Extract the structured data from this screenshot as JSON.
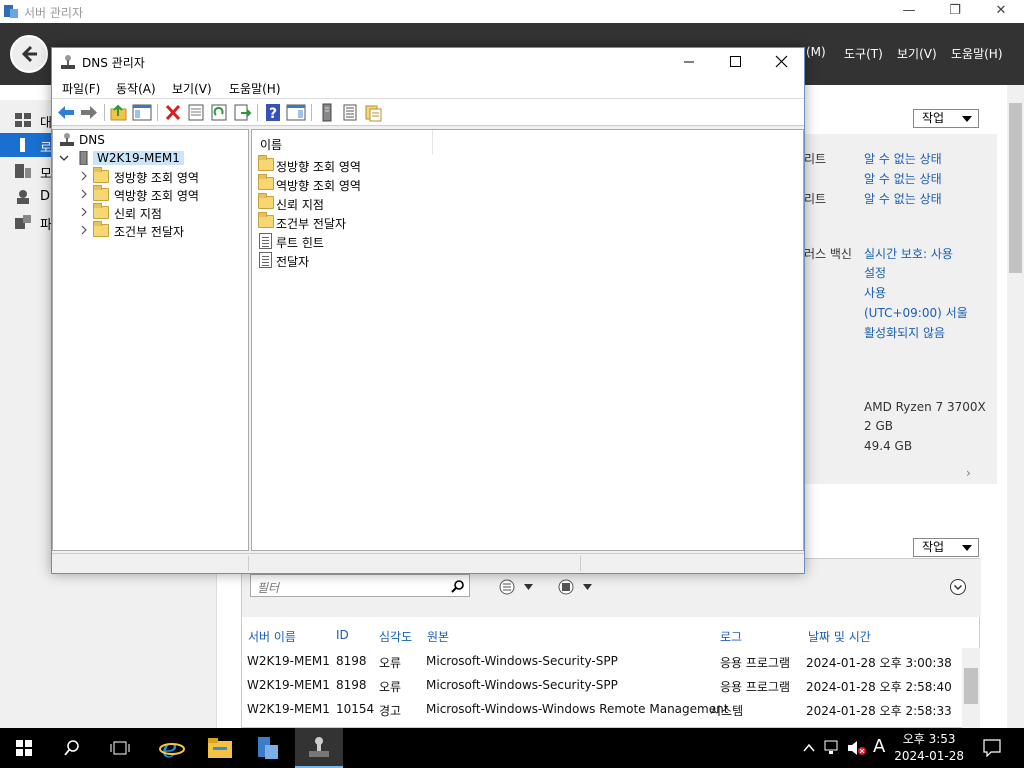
{
  "server_manager": {
    "window_title": "서버 관리자",
    "menu": [
      "(M)",
      "도구(T)",
      "보기(V)",
      "도움말(H)"
    ],
    "nav_items": [
      {
        "label": "대",
        "icon": "dashboard-icon"
      },
      {
        "label": "로",
        "icon": "info-icon"
      },
      {
        "label": "모",
        "icon": "servers-icon"
      },
      {
        "label": "D",
        "icon": "dns-icon"
      },
      {
        "label": "파",
        "icon": "file-services-icon"
      }
    ],
    "task_label": "작업",
    "properties": [
      {
        "label": "리트",
        "value": "알 수 없는 상태"
      },
      {
        "label": "",
        "value": "알 수 없는 상태"
      },
      {
        "label": "리트",
        "value": "알 수 없는 상태"
      },
      {
        "label": "러스 백신",
        "value": "실시간 보호: 사용"
      },
      {
        "label": "",
        "value": "설정"
      },
      {
        "label": "",
        "value": "사용"
      },
      {
        "label": "",
        "value": "(UTC+09:00) 서울"
      },
      {
        "label": "",
        "value": "활성화되지 않음"
      }
    ],
    "hardware": [
      "AMD Ryzen 7 3700X",
      "2 GB",
      "49.4 GB"
    ],
    "events": {
      "filter_placeholder": "필터",
      "columns": [
        "서버 이름",
        "ID",
        "심각도",
        "원본",
        "로그",
        "날짜 및 시간"
      ],
      "rows": [
        [
          "W2K19-MEM1",
          "8198",
          "오류",
          "Microsoft-Windows-Security-SPP",
          "응용 프로그램",
          "2024-01-28 오후 3:00:38"
        ],
        [
          "W2K19-MEM1",
          "8198",
          "오류",
          "Microsoft-Windows-Security-SPP",
          "응용 프로그램",
          "2024-01-28 오후 2:58:40"
        ],
        [
          "W2K19-MEM1",
          "10154",
          "경고",
          "Microsoft-Windows-Windows Remote Management",
          "시스템",
          "2024-01-28 오후 2:58:33"
        ]
      ]
    }
  },
  "dns_manager": {
    "title": "DNS 관리자",
    "menu": [
      "파일(F)",
      "동작(A)",
      "보기(V)",
      "도움말(H)"
    ],
    "tree": {
      "root": "DNS",
      "server": "W2K19-MEM1",
      "children": [
        "정방향 조회 영역",
        "역방향 조회 영역",
        "신뢰 지점",
        "조건부 전달자"
      ]
    },
    "list_header": "이름",
    "list_items": [
      {
        "label": "정방향 조회 영역",
        "icon": "folder-icon"
      },
      {
        "label": "역방향 조회 영역",
        "icon": "folder-icon"
      },
      {
        "label": "신뢰 지점",
        "icon": "folder-icon"
      },
      {
        "label": "조건부 전달자",
        "icon": "folder-icon"
      },
      {
        "label": "루트 힌트",
        "icon": "document-icon"
      },
      {
        "label": "전달자",
        "icon": "document-icon"
      }
    ]
  },
  "taskbar": {
    "time": "오후 3:53",
    "date": "2024-01-28",
    "ime": "A"
  }
}
